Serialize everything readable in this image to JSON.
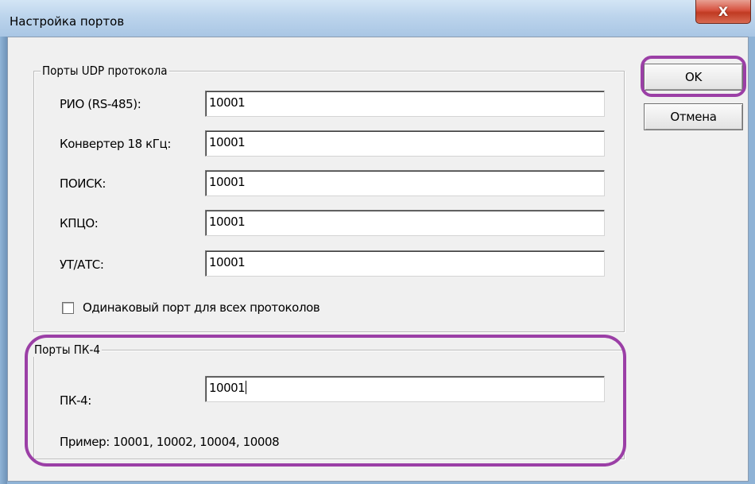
{
  "dialog": {
    "title": "Настройка портов",
    "close_symbol": "X"
  },
  "udp_group": {
    "label": "Порты UDP протокола",
    "fields": [
      {
        "label": "РИО (RS-485):",
        "value": "10001"
      },
      {
        "label": "Конвертер 18 кГц:",
        "value": "10001"
      },
      {
        "label": "ПОИСК:",
        "value": "10001"
      },
      {
        "label": "КПЦО:",
        "value": "10001"
      },
      {
        "label": "УТ/АТС:",
        "value": "10001"
      }
    ],
    "same_port_checkbox": {
      "label": "Одинаковый порт для всех протоколов",
      "checked": false
    }
  },
  "pk4_group": {
    "label": "Порты ПК-4",
    "field_label": "ПК-4:",
    "field_value": "10001",
    "example": "Пример: 10001, 10002, 10004, 10008"
  },
  "buttons": {
    "ok": "OK",
    "cancel": "Отмена"
  },
  "colors": {
    "highlight": "#9b3fa6",
    "dialog_bg": "#f0f0f0",
    "titlebar": "#bcd4ec",
    "close_button": "#c03a22"
  }
}
